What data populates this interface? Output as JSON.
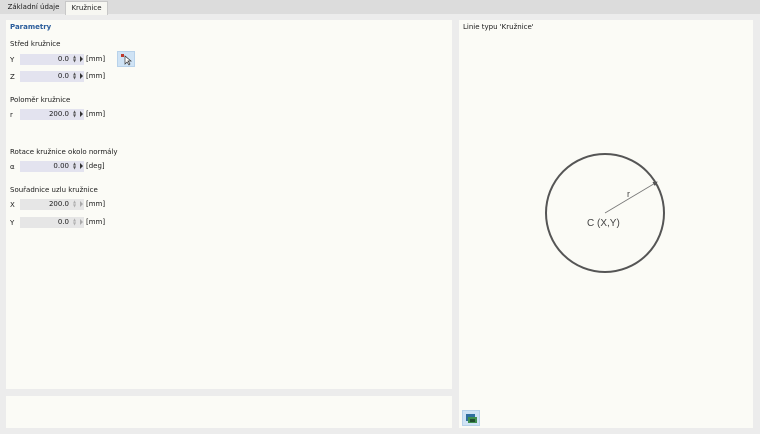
{
  "tabs": [
    {
      "label": "Základní údaje"
    },
    {
      "label": "Kružnice"
    }
  ],
  "params": {
    "title": "Parametry",
    "center": {
      "title": "Střed kružnice",
      "y": {
        "label": "Y",
        "value": "0.0",
        "unit": "[mm]"
      },
      "z": {
        "label": "Z",
        "value": "0.0",
        "unit": "[mm]"
      }
    },
    "radius": {
      "title": "Poloměr kružnice",
      "r": {
        "label": "r",
        "value": "200.0",
        "unit": "[mm]"
      }
    },
    "rotation": {
      "title": "Rotace kružnice okolo normály",
      "alpha": {
        "label": "α",
        "value": "0.00",
        "unit": "[deg]"
      }
    },
    "node": {
      "title": "Souřadnice uzlu kružnice",
      "x": {
        "label": "X",
        "value": "200.0",
        "unit": "[mm]"
      },
      "y": {
        "label": "Y",
        "value": "0.0",
        "unit": "[mm]"
      }
    }
  },
  "preview": {
    "title": "Linie typu 'Kružnice'",
    "r_label": "r",
    "center_label": "C (X,Y)"
  },
  "icons": {
    "pick": "pick-node-cursor-icon",
    "image": "show-image-icon"
  }
}
